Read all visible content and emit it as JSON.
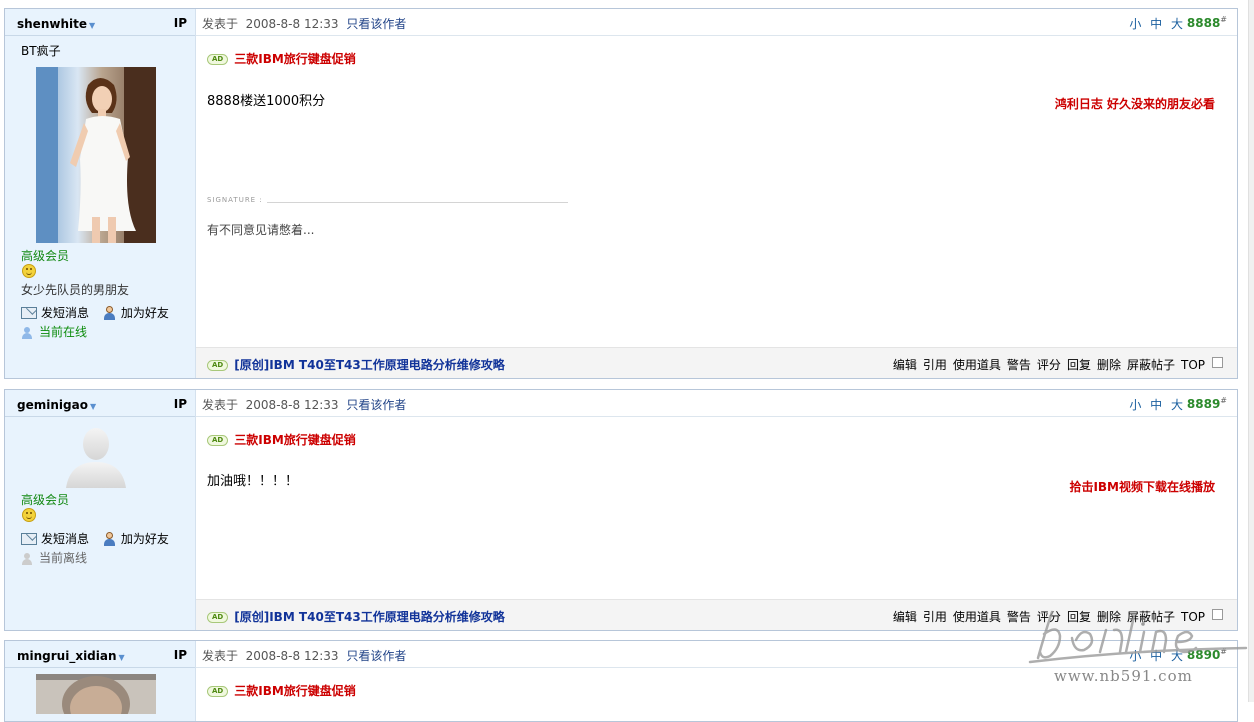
{
  "ui": {
    "ip_label": "IP",
    "post_prefix": "发表于",
    "only_author": "只看该作者",
    "font_sizes": "小 中 大",
    "signature_label": "SIGNATURE :",
    "ad_badge": "AD",
    "send_msg": "发短消息",
    "add_friend": "加为好友",
    "options": [
      "编辑",
      "引用",
      "使用道具",
      "警告",
      "评分",
      "回复",
      "删除",
      "屏蔽帖子",
      "TOP"
    ]
  },
  "posts": [
    {
      "username": "shenwhite",
      "title": "BT疯子",
      "rank": "高级会员",
      "user_title": "女少先队员的男朋友",
      "status": "当前在线",
      "date": "2008-8-8 12:33",
      "floor": "8888",
      "ad_text": "三款IBM旅行键盘促销",
      "content": "8888楼送1000积分",
      "side_ad": "鸿利日志  好久没来的朋友必看",
      "signature": "有不同意见请憋着...",
      "bottom_ad": "[原创]IBM T40至T43工作原理电路分析维修攻略"
    },
    {
      "username": "geminigao",
      "rank": "高级会员",
      "status": "当前离线",
      "date": "2008-8-8 12:33",
      "floor": "8889",
      "ad_text": "三款IBM旅行键盘促销",
      "content": "加油哦！！！！",
      "side_ad": "拾击IBM视频下载在线播放",
      "bottom_ad": "[原创]IBM T40至T43工作原理电路分析维修攻略"
    },
    {
      "username": "mingrui_xidian",
      "date": "2008-8-8 12:33",
      "floor": "8890",
      "ad_text": "三款IBM旅行键盘促销"
    }
  ],
  "watermark": {
    "logo": "nbonline",
    "url": "www.nb591.com"
  },
  "colors": {
    "sidebar_bg": "#e8f3fd",
    "floor_green": "#2c8a2c",
    "ad_red": "#cc0000",
    "link_blue": "#113399"
  }
}
